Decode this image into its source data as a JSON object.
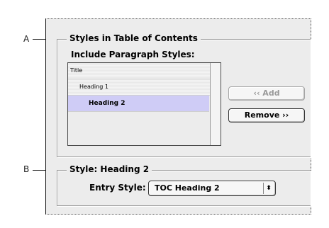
{
  "callouts": {
    "a": "A",
    "b": "B"
  },
  "toc_section": {
    "title": "Styles in Table of Contents",
    "include_label": "Include Paragraph Styles:",
    "included_styles": [
      {
        "label": "Title",
        "selected": false
      },
      {
        "label": "Heading 1",
        "selected": false
      },
      {
        "label": "Heading 2",
        "selected": true
      }
    ],
    "add_button": "‹‹ Add",
    "remove_button": "Remove ››"
  },
  "style_section": {
    "title": "Style: Heading 2",
    "entry_style_label": "Entry Style:",
    "entry_style_value": "TOC Heading 2"
  },
  "colors": {
    "dialog_background": "#ececec",
    "selected_row": "#cfccf6",
    "disabled_text": "#9a9a9a"
  }
}
